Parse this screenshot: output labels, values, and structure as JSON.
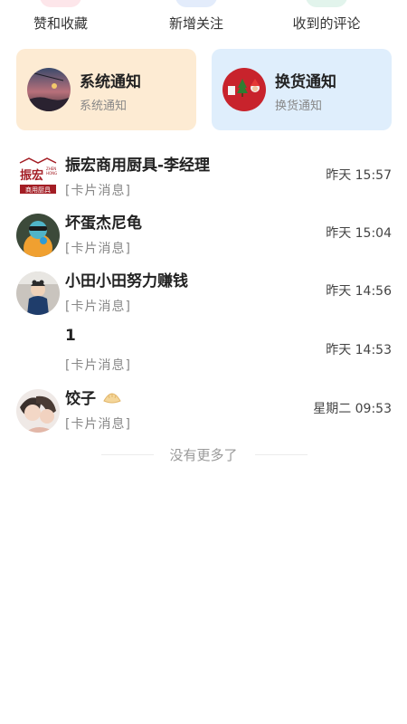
{
  "top_actions": [
    {
      "label": "赞和收藏"
    },
    {
      "label": "新增关注"
    },
    {
      "label": "收到的评论"
    }
  ],
  "notices": [
    {
      "title": "系统通知",
      "subtitle": "系统通知"
    },
    {
      "title": "换货通知",
      "subtitle": "换货通知"
    }
  ],
  "conversations": [
    {
      "name": "振宏商用厨具-李经理",
      "preview": "[卡片消息]",
      "time": "昨天 15:57",
      "logo_text": "振宏",
      "logo_sub": "商用厨具"
    },
    {
      "name": "坏蛋杰尼龟",
      "preview": "[卡片消息]",
      "time": "昨天 15:04"
    },
    {
      "name": "小田小田努力赚钱",
      "preview": "[卡片消息]",
      "time": "昨天 14:56"
    },
    {
      "name": "1",
      "preview": "[卡片消息]",
      "time": "昨天 14:53"
    },
    {
      "name": "饺子",
      "preview": "[卡片消息]",
      "time": "星期二 09:53"
    }
  ],
  "footer": {
    "text": "没有更多了"
  },
  "colors": {
    "system_card": "#fdebd3",
    "exchange_card": "#dfeefc"
  }
}
